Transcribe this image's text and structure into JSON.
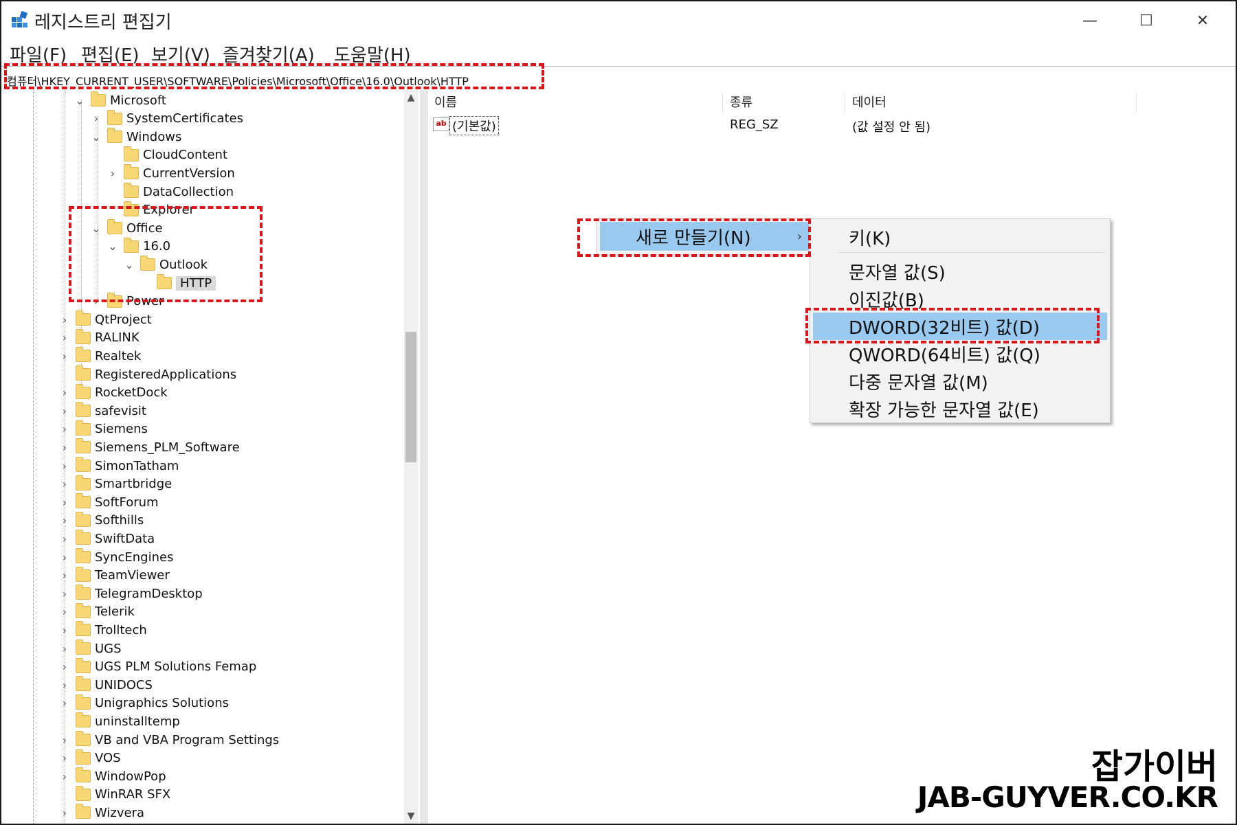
{
  "window": {
    "title": "레지스트리 편집기"
  },
  "menubar": [
    "파일(F)",
    "편집(E)",
    "보기(V)",
    "즐겨찾기(A)",
    "도움말(H)"
  ],
  "address": "컴퓨터\\HKEY_CURRENT_USER\\SOFTWARE\\Policies\\Microsoft\\Office\\16.0\\Outlook\\HTTP",
  "tree": [
    {
      "label": "Microsoft",
      "expanded": true
    },
    {
      "label": "SystemCertificates",
      "expanded": false
    },
    {
      "label": "Windows",
      "expanded": true
    },
    {
      "label": "CloudContent",
      "expanded": null
    },
    {
      "label": "CurrentVersion",
      "expanded": false
    },
    {
      "label": "DataCollection",
      "expanded": null
    },
    {
      "label": "Explorer",
      "expanded": null
    },
    {
      "label": "Office",
      "expanded": true
    },
    {
      "label": "16.0",
      "expanded": true
    },
    {
      "label": "Outlook",
      "expanded": true
    },
    {
      "label": "HTTP",
      "expanded": null,
      "selected": true
    },
    {
      "label": "Power",
      "expanded": false
    },
    {
      "label": "QtProject",
      "expanded": false
    },
    {
      "label": "RALINK",
      "expanded": false
    },
    {
      "label": "Realtek",
      "expanded": false
    },
    {
      "label": "RegisteredApplications",
      "expanded": null
    },
    {
      "label": "RocketDock",
      "expanded": false
    },
    {
      "label": "safevisit",
      "expanded": false
    },
    {
      "label": "Siemens",
      "expanded": false
    },
    {
      "label": "Siemens_PLM_Software",
      "expanded": false
    },
    {
      "label": "SimonTatham",
      "expanded": false
    },
    {
      "label": "Smartbridge",
      "expanded": false
    },
    {
      "label": "SoftForum",
      "expanded": false
    },
    {
      "label": "Softhills",
      "expanded": false
    },
    {
      "label": "SwiftData",
      "expanded": false
    },
    {
      "label": "SyncEngines",
      "expanded": false
    },
    {
      "label": "TeamViewer",
      "expanded": false
    },
    {
      "label": "TelegramDesktop",
      "expanded": false
    },
    {
      "label": "Telerik",
      "expanded": false
    },
    {
      "label": "Trolltech",
      "expanded": false
    },
    {
      "label": "UGS",
      "expanded": false
    },
    {
      "label": "UGS PLM Solutions Femap",
      "expanded": false
    },
    {
      "label": "UNIDOCS",
      "expanded": false
    },
    {
      "label": "Unigraphics Solutions",
      "expanded": false
    },
    {
      "label": "uninstalltemp",
      "expanded": null
    },
    {
      "label": "VB and VBA Program Settings",
      "expanded": false
    },
    {
      "label": "VOS",
      "expanded": false
    },
    {
      "label": "WindowPop",
      "expanded": false
    },
    {
      "label": "WinRAR SFX",
      "expanded": null
    },
    {
      "label": "Wizvera",
      "expanded": false
    }
  ],
  "list": {
    "headers": [
      "이름",
      "종류",
      "데이터"
    ],
    "rows": [
      {
        "name": "(기본값)",
        "type": "REG_SZ",
        "data": "(값 설정 안 됨)"
      }
    ]
  },
  "context_menu": {
    "new_label": "새로 만들기(N)",
    "submenu": [
      "키(K)",
      "문자열 값(S)",
      "이진값(B)",
      "DWORD(32비트) 값(D)",
      "QWORD(64비트) 값(Q)",
      "다중 문자열 값(M)",
      "확장 가능한 문자열 값(E)"
    ]
  },
  "watermark": {
    "line1": "잡가이버",
    "line2": "JAB-GUYVER.CO.KR"
  },
  "colors": {
    "highlight": "#99c9ef",
    "annotation": "#d9161a",
    "folder": "#f8d775"
  }
}
